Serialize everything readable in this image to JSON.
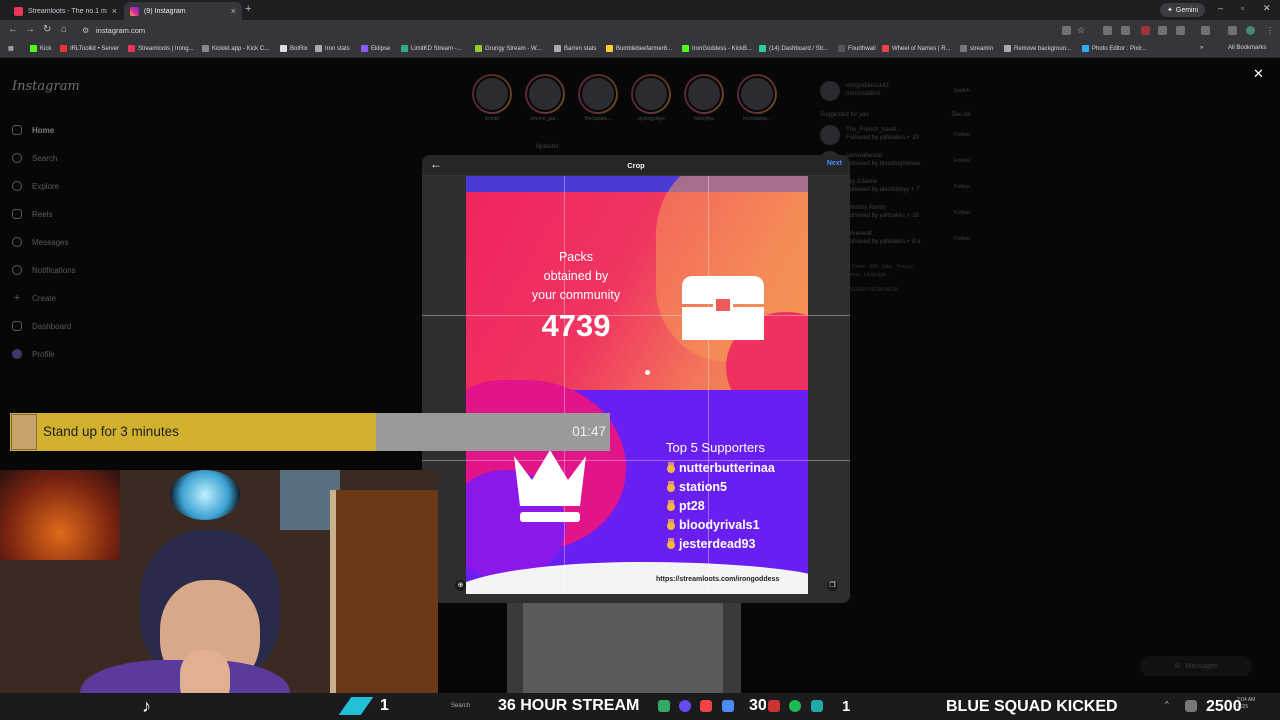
{
  "browser": {
    "tabs": [
      {
        "title": "Streamloots - The no.1 monetiz",
        "active": false
      },
      {
        "title": "(9) Instagram",
        "active": true
      }
    ],
    "url": "instagram.com",
    "gemini_label": "Gemini",
    "bookmarks": [
      "Kick",
      "IRLToolkit • Server",
      "Streamloots | Irong...",
      "Kicklet.app - Kick C...",
      "BotRix",
      "Iron stats",
      "Eklipse",
      "LimitKD Stream -...",
      "Grungy Stream - W...",
      "Barren stats",
      "Bumblebeefarmer8...",
      "IronGoddess - KickB...",
      "(14) Dashboard / Str...",
      "Fourthwall",
      "Wheel of Names | R...",
      "streamin",
      "Remove backgroun...",
      "Photo Editor : Pixlr..."
    ],
    "all_bookmarks": "All Bookmarks"
  },
  "instagram": {
    "logo": "Instagram",
    "nav": [
      "Home",
      "Search",
      "Explore",
      "Reels",
      "Messages",
      "Notifications",
      "Create",
      "Dashboard",
      "Profile"
    ],
    "stories": [
      "lirontd",
      "xmmm_par...",
      "thecaptain...",
      "stylongplays",
      "mikeyfpe",
      "incredarpa..."
    ],
    "post_author": "lilpeteter",
    "account": {
      "username": "irongoddess143",
      "name": "IronGoddess",
      "switch": "Switch"
    },
    "suggested_title": "Suggested for you",
    "see_all": "See All",
    "suggestions": [
      {
        "name": "The_French_travel...",
        "sub": "Followed by yahbakes + 20",
        "action": "Follow"
      },
      {
        "name": "samwallaceal",
        "sub": "Followed by bloodlogherwer",
        "action": "Follow"
      },
      {
        "name": "Big J/Jamie",
        "sub": "Followed by alexfelsbyy + 7",
        "action": "Follow"
      },
      {
        "name": "Timothy Randy",
        "sub": "Followed by yahbakes + 16",
        "action": "Follow"
      },
      {
        "name": "Silverwolf",
        "sub": "Followed by yahbakes + 8 a",
        "action": "Follow"
      }
    ],
    "footer": [
      "About · Help · Press · API · Jobs · Privacy ·",
      "Terms · Locations · Language ·",
      "Meta Verified",
      "© 2025 INSTAGRAM FROM META"
    ],
    "messages_label": "Messages"
  },
  "crop_modal": {
    "title": "Crop",
    "next": "Next",
    "back_icon": "arrow-left-icon",
    "close_icon": "close-icon"
  },
  "card": {
    "packs_label_1": "Packs",
    "packs_label_2": "obtained by",
    "packs_label_3": "your community",
    "packs_value": "4739",
    "supporters_title": "Top 5 Supporters",
    "supporters": [
      "nutterbutterinaa",
      "station5",
      "pt28",
      "bloodyrivals1",
      "jesterdead93"
    ],
    "url": "https://streamloots.com/irongoddess",
    "colors": {
      "top": "#f0255f",
      "accent": "#f3785a",
      "bottom": "#6a1ff2",
      "pink": "#e2148a"
    }
  },
  "overlay": {
    "timer_label": "Stand up for 3 minutes",
    "timer_time": "01:47",
    "timer_progress": 0.61,
    "count_left": "1",
    "stream_banner": "36 HOUR STREAM",
    "count_mid": "30",
    "count_right": "1",
    "squad_banner": "BLUE SQUAD KICKED",
    "score": "2500"
  },
  "taskbar": {
    "search_label": "Search",
    "time": "2:04 AM",
    "date": "2025"
  }
}
